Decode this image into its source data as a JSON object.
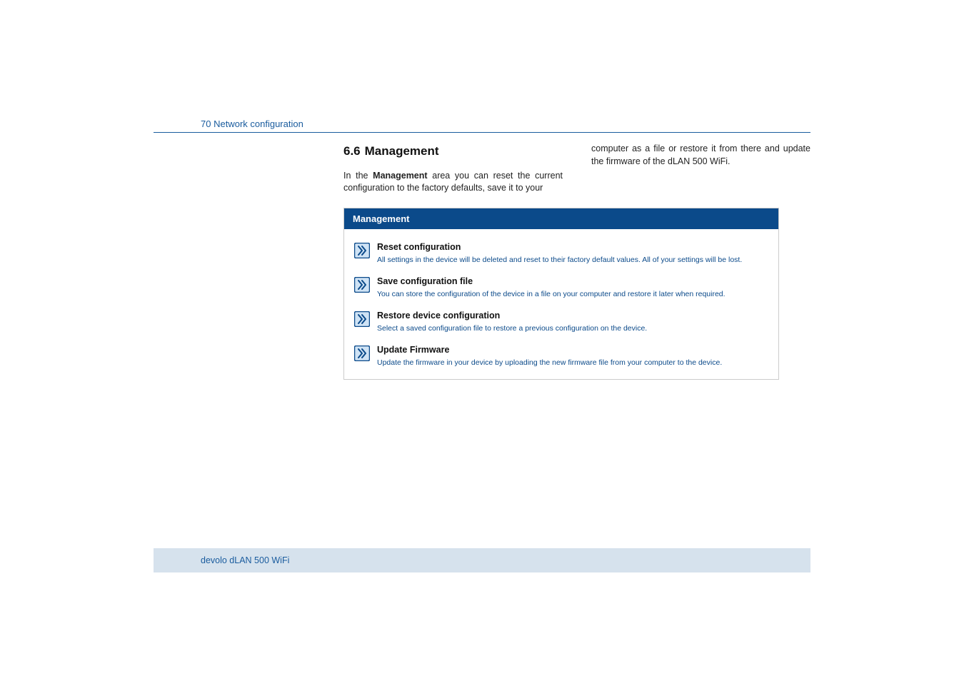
{
  "header": {
    "page_number": "70",
    "chapter": "Network configuration"
  },
  "section": {
    "number": "6.6",
    "title": "Management"
  },
  "intro": {
    "col1_prefix": "In the ",
    "col1_bold": "Management",
    "col1_suffix": " area you can reset the current configuration to the factory defaults, save it to your",
    "col2": "computer as a file or restore it from there and update the firmware of the dLAN 500 WiFi."
  },
  "panel": {
    "title": "Management",
    "items": [
      {
        "title": "Reset configuration",
        "desc": "All settings in the device will be deleted and reset to their factory default values. All of your settings will be lost."
      },
      {
        "title": "Save configuration file",
        "desc": "You can store the configuration of the device in a file on your computer and restore it later when required."
      },
      {
        "title": "Restore device configuration",
        "desc": "Select a saved configuration file to restore a previous configuration on the device."
      },
      {
        "title": "Update Firmware",
        "desc": "Update the firmware in your device by uploading the new firmware file from your computer to the device."
      }
    ]
  },
  "footer": {
    "text": "devolo dLAN 500 WiFi"
  }
}
